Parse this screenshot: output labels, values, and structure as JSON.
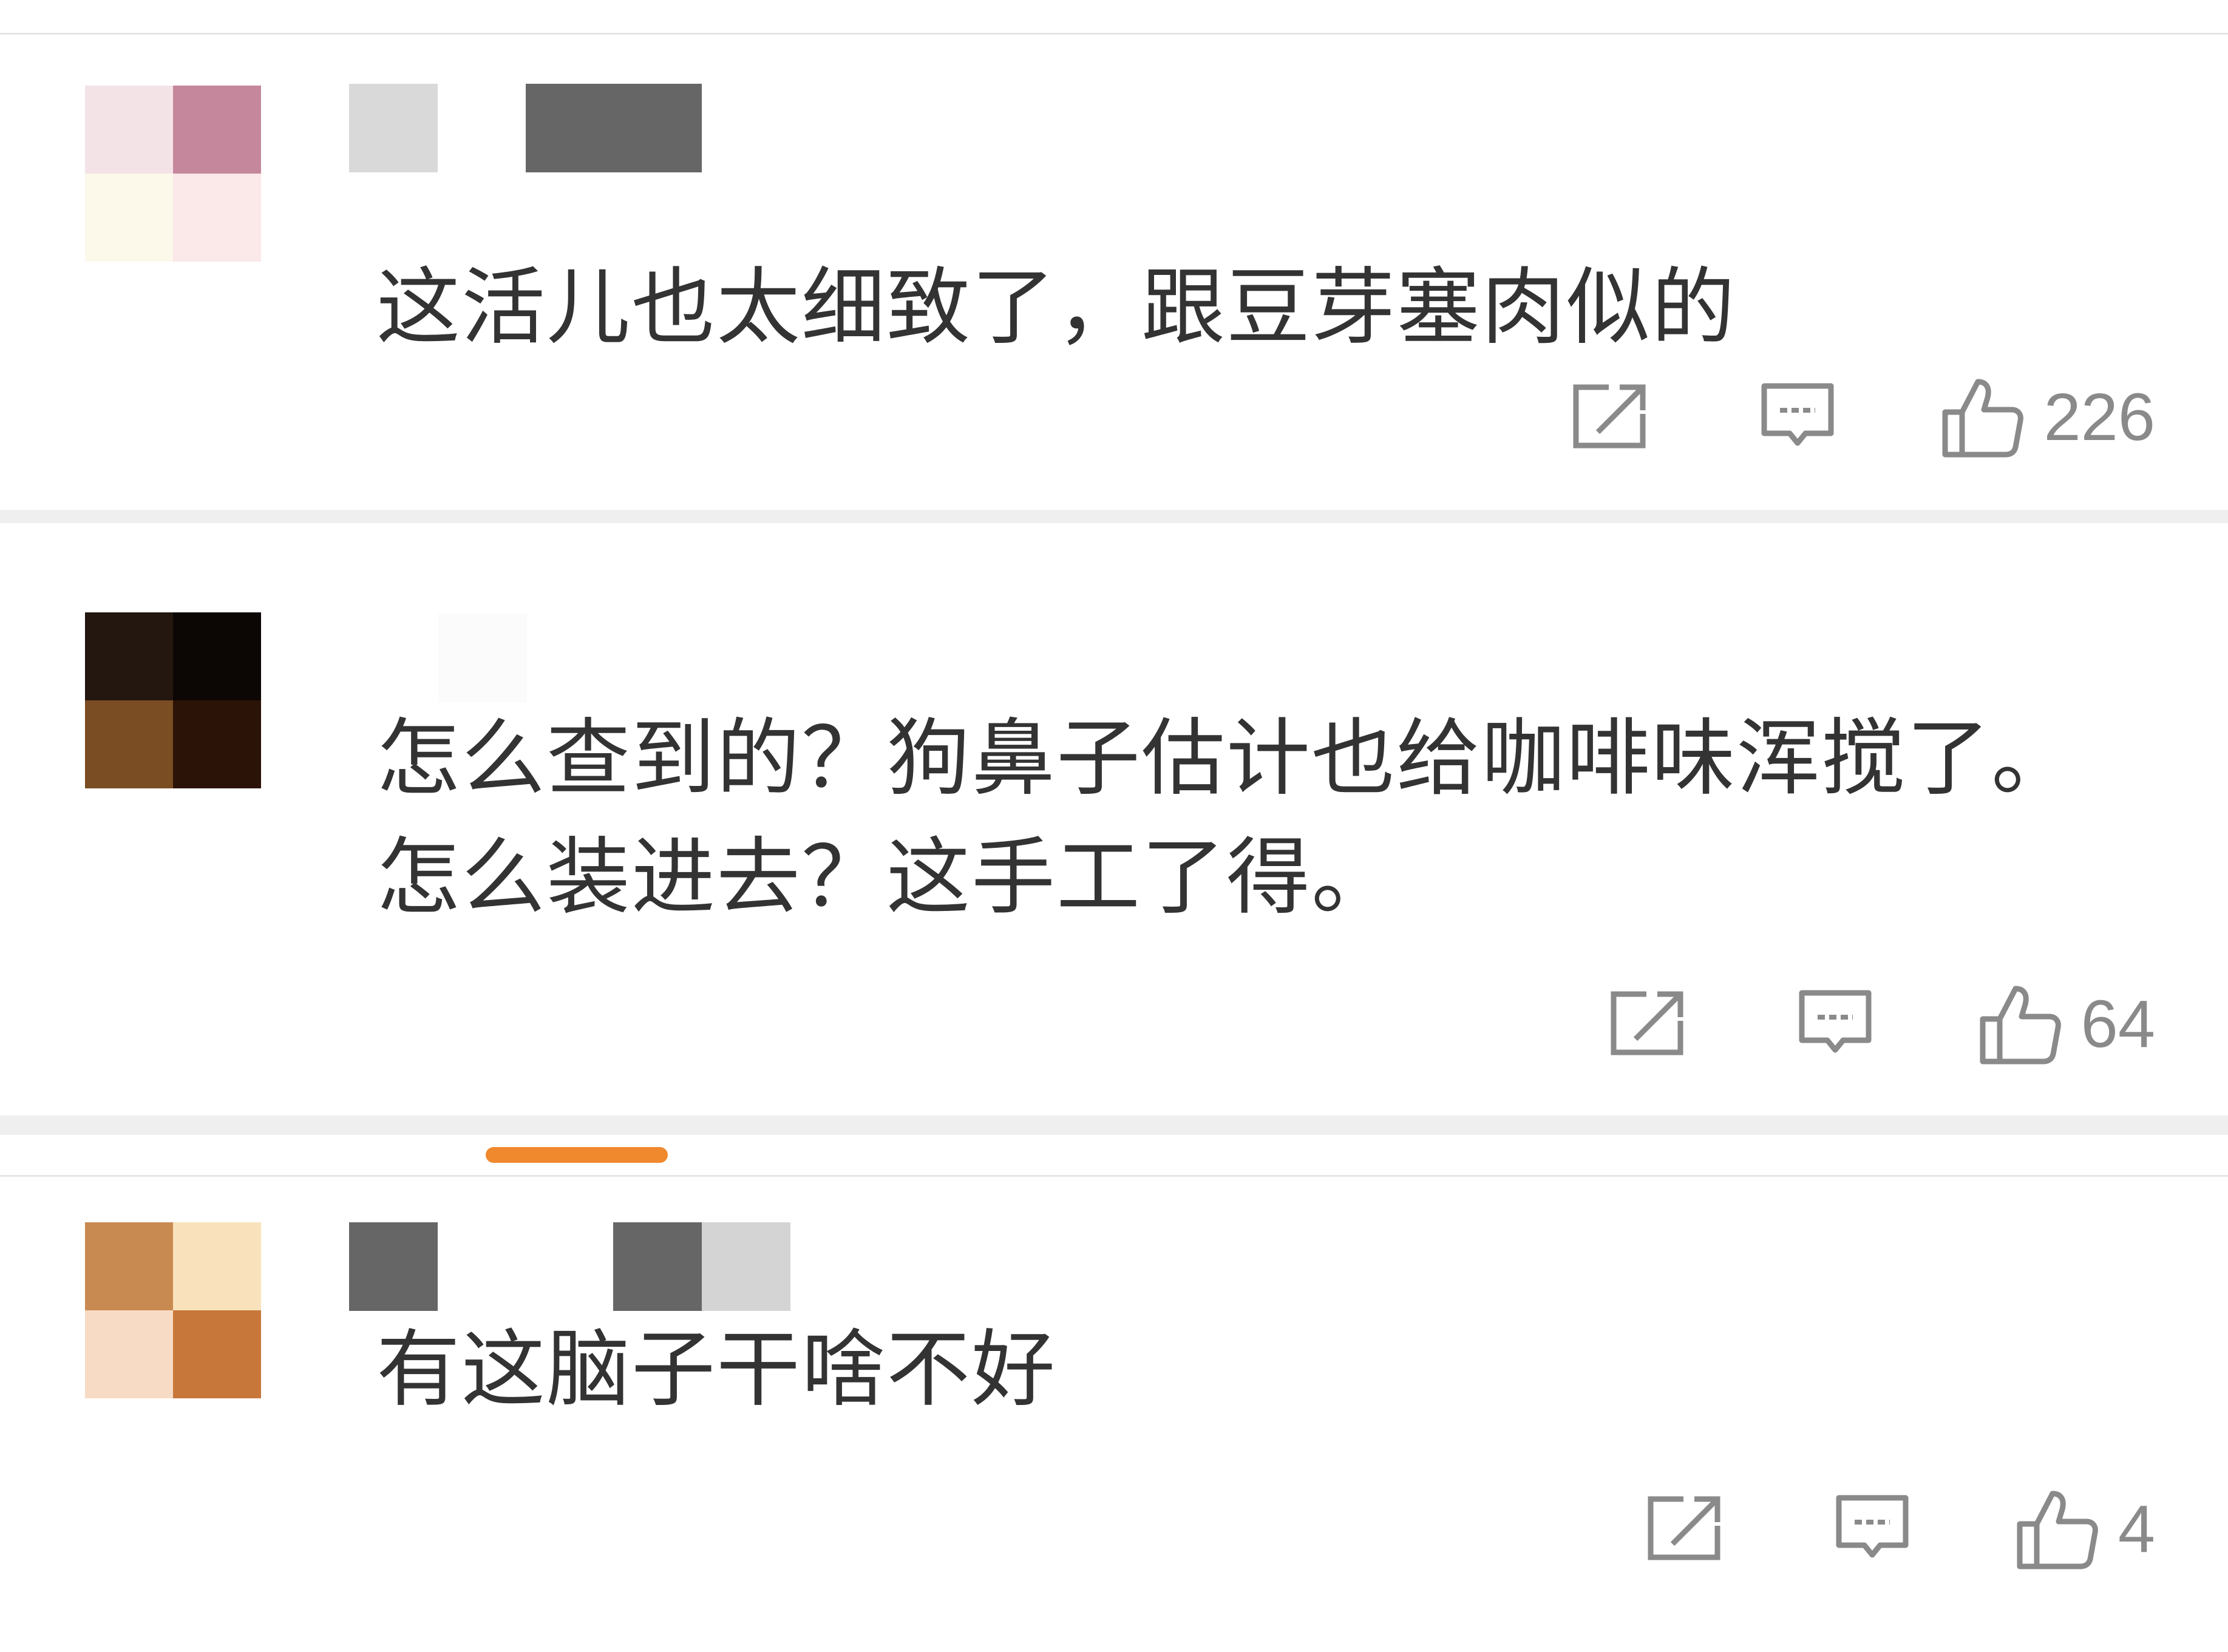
{
  "comments": [
    {
      "text": "这活儿也太细致了，跟豆芽塞肉似的",
      "likes": "226",
      "avatar_colors": [
        "#f4e3e6",
        "#c4879c",
        "#fcf8ea",
        "#fbe8e8",
        "#a9aab6",
        "#d5ecf4"
      ]
    },
    {
      "text": "怎么查到的？狗鼻子估计也给咖啡味浑搅了。怎么装进去？这手工了得。",
      "likes": "64",
      "avatar_colors": [
        "#231710",
        "#0c0704",
        "#7a4d22",
        "#2b1307"
      ]
    },
    {
      "text": "有这脑子干啥不好",
      "likes": "4",
      "avatar_colors": [
        "#c98a52",
        "#f9e2bb",
        "#f8dbc4",
        "#c8773a",
        "#703e28",
        "#2a1a16"
      ]
    }
  ],
  "icons": {
    "share": "share-icon",
    "reply": "comment-icon",
    "like": "thumbs-up-icon"
  },
  "colors": {
    "text": "#333333",
    "meta": "#8a8a8a",
    "separator": "#efefef",
    "accent": "#f0882e"
  }
}
